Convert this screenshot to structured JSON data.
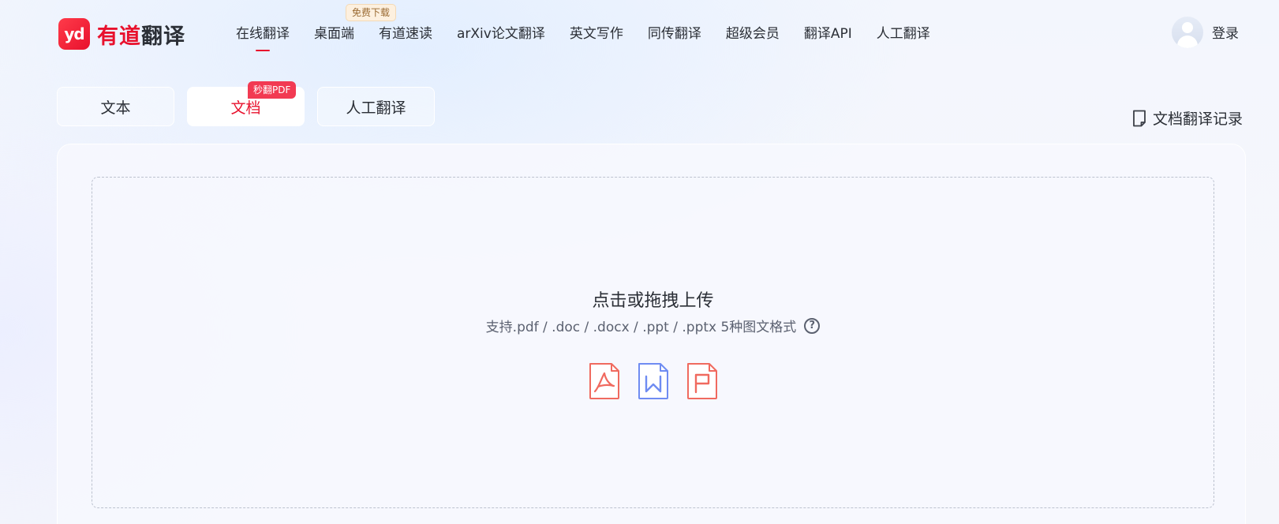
{
  "logo": {
    "mark": "yd",
    "text_red": "有道",
    "text_dark": "翻译"
  },
  "nav": {
    "items": [
      "在线翻译",
      "桌面端",
      "有道速读",
      "arXiv论文翻译",
      "英文写作",
      "同传翻译",
      "超级会员",
      "翻译API",
      "人工翻译"
    ],
    "active_index": 0,
    "badge": "免费下载"
  },
  "user": {
    "login_label": "登录"
  },
  "tabs": {
    "items": [
      "文本",
      "文档",
      "人工翻译"
    ],
    "active_index": 1,
    "badge": "秒翻PDF"
  },
  "history": {
    "label": "文档翻译记录"
  },
  "upload": {
    "title": "点击或拖拽上传",
    "subtitle": "支持.pdf / .doc / .docx / .ppt / .pptx 5种图文格式",
    "help_symbol": "?",
    "file_types": [
      "pdf-icon",
      "word-icon",
      "ppt-icon"
    ]
  },
  "colors": {
    "brand": "#e8112d",
    "pdf": "#f06a5f",
    "word": "#6f8cf2",
    "ppt": "#f06a5f"
  }
}
